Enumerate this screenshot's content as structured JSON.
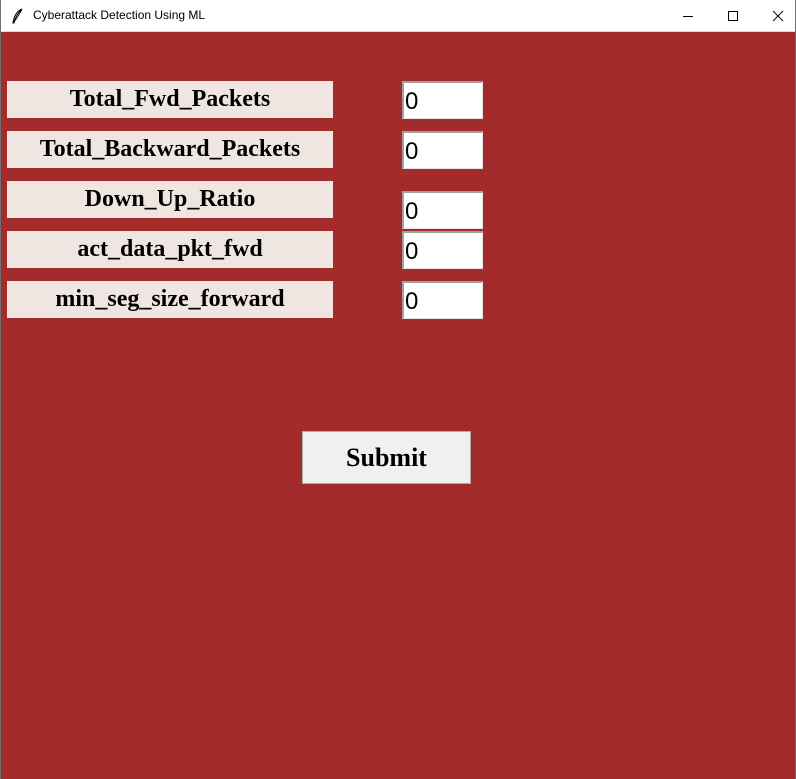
{
  "window": {
    "title": "Cyberattack Detection Using ML"
  },
  "form": {
    "fields": [
      {
        "label": "Total_Fwd_Packets",
        "value": "0"
      },
      {
        "label": "Total_Backward_Packets",
        "value": "0"
      },
      {
        "label": "Down_Up_Ratio",
        "value": "0"
      },
      {
        "label": "act_data_pkt_fwd",
        "value": "0"
      },
      {
        "label": "min_seg_size_forward",
        "value": "0"
      }
    ],
    "submit_label": "Submit"
  },
  "colors": {
    "background": "#a32b2b",
    "label_bg": "#efe6e1",
    "button_bg": "#f0f0f0"
  },
  "icons": {
    "app": "feather-icon",
    "minimize": "minimize-icon",
    "maximize": "maximize-icon",
    "close": "close-icon"
  }
}
